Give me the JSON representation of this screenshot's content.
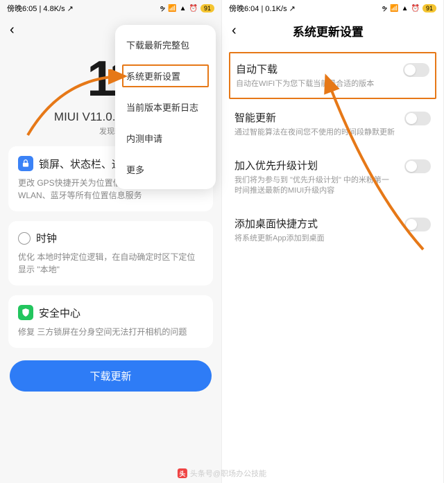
{
  "left": {
    "status": {
      "time": "傍晚6:05",
      "net": "4.8K/s",
      "battery": "91"
    },
    "big_num": "11",
    "version": "MIUI V11.0.4.0.QFAC",
    "version_sub": "发现新",
    "popup": {
      "item0": "下载最新完整包",
      "item1": "系统更新设置",
      "item2": "当前版本更新日志",
      "item3": "内测申请",
      "item4": "更多"
    },
    "card1": {
      "title": "锁屏、状态栏、通知",
      "desc": "更改 GPS快捷开关为位置信息，控制GPS、WLAN、蓝牙等所有位置信息服务"
    },
    "card2": {
      "title": "时钟",
      "desc": "优化 本地时钟定位逻辑，在自动确定时区下定位显示 \"本地\""
    },
    "card3": {
      "title": "安全中心",
      "desc": "修复 三方锁屏在分身空间无法打开相机的问题"
    },
    "download_btn": "下载更新"
  },
  "right": {
    "status": {
      "time": "傍晚6:04",
      "net": "0.1K/s",
      "battery": "91"
    },
    "title": "系统更新设置",
    "settings": {
      "s0": {
        "title": "自动下载",
        "sub": "自动在WIFI下为您下载当前最合适的版本"
      },
      "s1": {
        "title": "智能更新",
        "sub": "通过智能算法在夜间您不使用的时间段静默更新"
      },
      "s2": {
        "title": "加入优先升级计划",
        "sub": "我们将为参与到 \"优先升级计划\" 中的米粉第一时间推送最新的MIUI升级内容"
      },
      "s3": {
        "title": "添加桌面快捷方式",
        "sub": "将系统更新App添加到桌面"
      }
    }
  },
  "watermark": "头条号@职场办公技能"
}
